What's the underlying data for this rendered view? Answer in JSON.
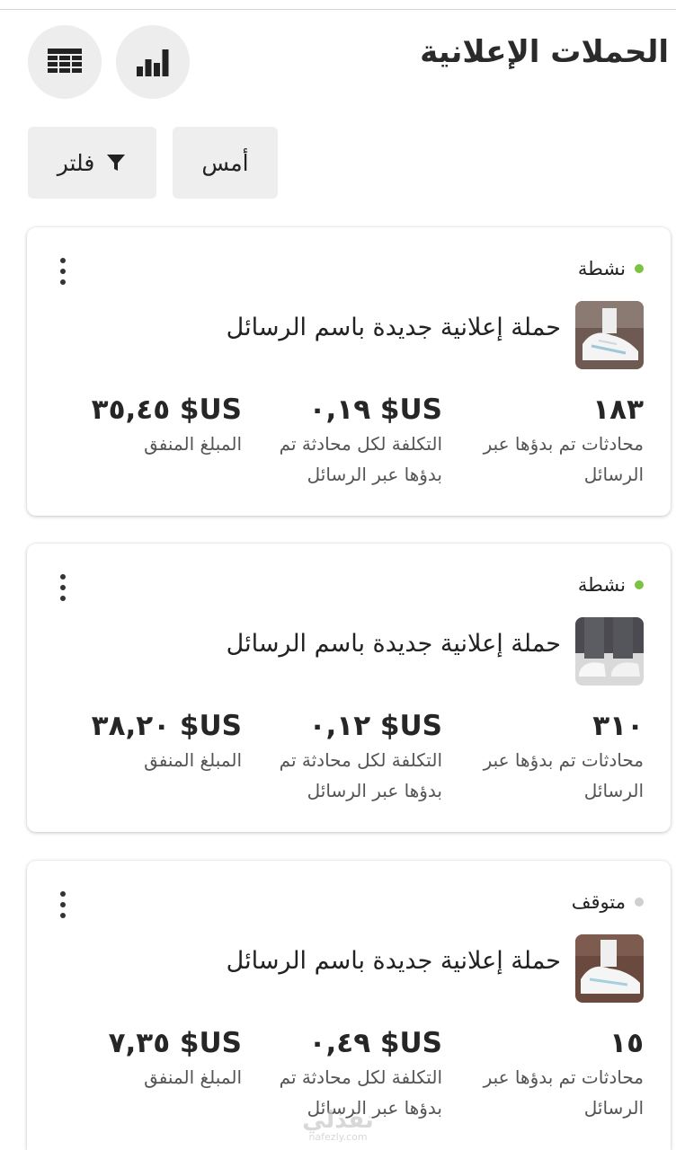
{
  "header": {
    "title": "الحملات الإعلانية",
    "chart_button_icon": "bar-chart-icon",
    "table_button_icon": "table-icon"
  },
  "toolbar": {
    "date_label": "أمس",
    "filter_label": "فلتر",
    "filter_icon": "funnel-icon"
  },
  "campaigns": [
    {
      "status": "نشطة",
      "status_color": "#7cc243",
      "name": "حملة إعلانية جديدة باسم الرسائل",
      "conversations": "١٨٣",
      "conversations_label": "محادثات تم بدؤها عبر الرسائل",
      "cost_per": "US$ ٠,١٩",
      "cost_per_label": "التكلفة لكل محادثة تم بدؤها عبر الرسائل",
      "spent": "US$ ٣٥,٤٥",
      "spent_label": "المبلغ المنفق",
      "thumbnail": "white-sneakers-image"
    },
    {
      "status": "نشطة",
      "status_color": "#7cc243",
      "name": "حملة إعلانية جديدة باسم الرسائل",
      "conversations": "٣١٠",
      "conversations_label": "محادثات تم بدؤها عبر الرسائل",
      "cost_per": "US$ ٠,١٢",
      "cost_per_label": "التكلفة لكل محادثة تم بدؤها عبر الرسائل",
      "spent": "US$ ٣٨,٢٠",
      "spent_label": "المبلغ المنفق",
      "thumbnail": "grey-pants-sneakers-image"
    },
    {
      "status": "متوقف",
      "status_color": "#cfcfcf",
      "name": "حملة إعلانية جديدة باسم الرسائل",
      "conversations": "١٥",
      "conversations_label": "محادثات تم بدؤها عبر الرسائل",
      "cost_per": "US$ ٠,٤٩",
      "cost_per_label": "التكلفة لكل محادثة تم بدؤها عبر الرسائل",
      "spent": "US$ ٧,٣٥",
      "spent_label": "المبلغ المنفق",
      "thumbnail": "white-sneakers-image"
    }
  ],
  "watermark": {
    "main": "نفذلي",
    "sub": "nafezly.com"
  }
}
